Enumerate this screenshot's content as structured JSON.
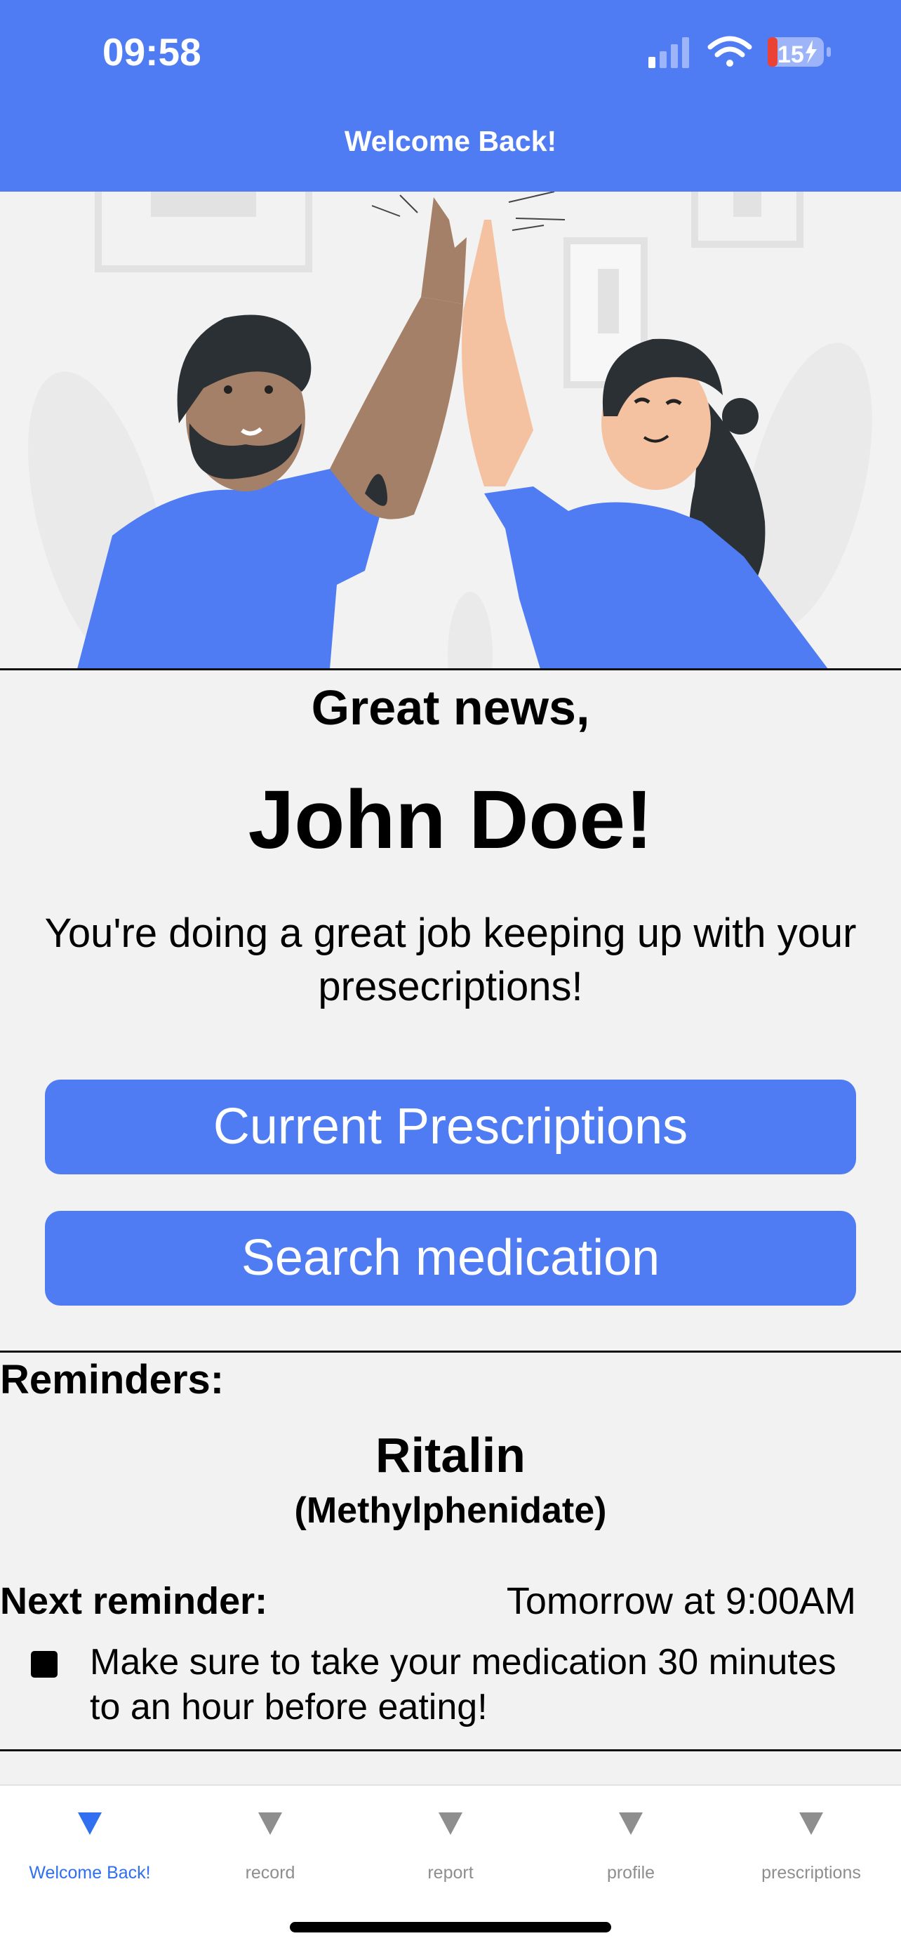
{
  "status_bar": {
    "time": "09:58",
    "battery": "15"
  },
  "header": {
    "title": "Welcome Back!"
  },
  "main": {
    "greeting": "Great news,",
    "user_name": "John Doe!",
    "message": "You're doing a great job keeping up with your presecriptions!",
    "buttons": {
      "current_prescriptions": "Current Prescriptions",
      "search_medication": "Search medication"
    }
  },
  "reminders": {
    "title": "Reminders:",
    "medication": {
      "name": "Ritalin",
      "generic": "(Methylphenidate)"
    },
    "next_reminder_label": "Next reminder:",
    "next_reminder_value": "Tomorrow at 9:00AM",
    "note": "Make sure to take your medication 30 minutes to an hour before eating!"
  },
  "tabbar": {
    "tabs": [
      {
        "label": "Welcome Back!",
        "icon": "triangle-down-icon",
        "active": true
      },
      {
        "label": "record",
        "icon": "triangle-down-icon",
        "active": false
      },
      {
        "label": "report",
        "icon": "triangle-down-icon",
        "active": false
      },
      {
        "label": "profile",
        "icon": "triangle-down-icon",
        "active": false
      },
      {
        "label": "prescriptions",
        "icon": "triangle-down-icon",
        "active": false
      }
    ]
  },
  "colors": {
    "accent": "#4f7bf3",
    "active_tab": "#2f6ff0",
    "inactive_tab": "#8e8e8e"
  }
}
